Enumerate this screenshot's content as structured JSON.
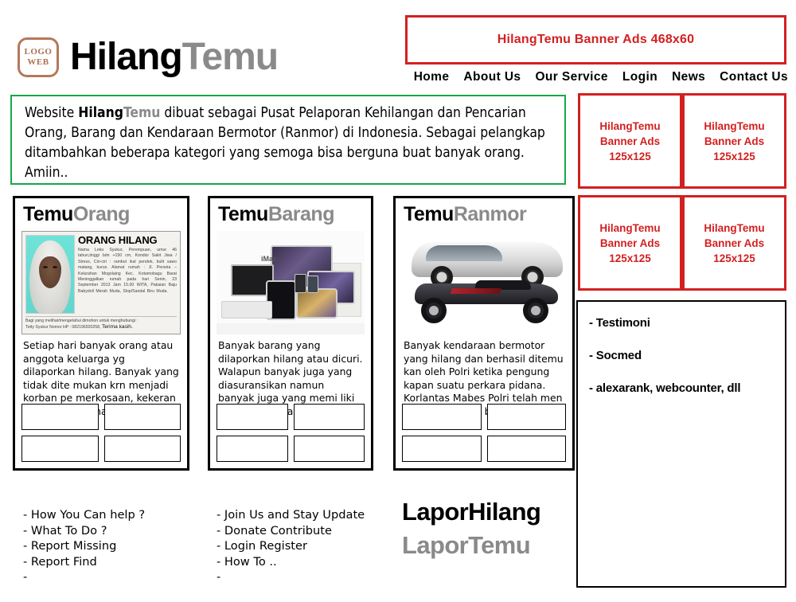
{
  "header": {
    "logo": {
      "line1": "LOGO",
      "line2": "WEB",
      "color": "#a9714f"
    },
    "title_black": "Hilang",
    "title_grey": "Temu",
    "nav": [
      {
        "label": "Home"
      },
      {
        "label": "About Us"
      },
      {
        "label": "Our Service"
      },
      {
        "label": "Login"
      },
      {
        "label": "News"
      },
      {
        "label": "Contact Us"
      }
    ]
  },
  "top_banner": {
    "label": "HilangTemu Banner Ads 468x60",
    "color": "#d32020"
  },
  "description": {
    "pre": "Website ",
    "brand_black": "Hilang",
    "brand_grey": "Temu",
    "rest": " dibuat sebagai Pusat Pelaporan Kehilangan dan Pencarian Orang, Barang dan Kendaraan Bermotor (Ranmor) di Indonesia. Sebagai pelangkap ditambahkan beberapa kategori yang semoga bisa berguna buat banyak orang. Amiin..",
    "border_color": "#17a74a"
  },
  "cards": [
    {
      "title_a": "Temu",
      "title_b": "Orang",
      "body": "Setiap hari banyak orang atau anggota keluarga yg dilaporkan hilang. Banyak yang tidak dite mukan krn menjadi korban pe merkosaan, kekeran dan pem bunuhan ...",
      "poster": {
        "heading": "ORANG HILANG",
        "lines": "Nama Leku Syukur, Perempuan, umur 46 tahun,tinggi bdn  +150 cm, Kondisi Sakit Jiwa / Stress, Ciri-ciri : rambut ikal pendek, bulit sawo matang, kurus. Alamat rumah : Jl. Perwira – Kelurahan Mogolaing Kec. Kotamobagu Barat Meninggalkan rumah pada hari Senin, 23 September 2013 Jam 15.00 WITA, Pakaian Baju Babydoll Merah Muda, Slop/Sandal Biru Muda.",
        "foot": "Bagi yang melihat/mengetahui dimohon untuk menghubungi :",
        "foot2": "Tetty Syukur   Nomor HP : 082196920258,",
        "foot3": "Terima kasih."
      }
    },
    {
      "title_a": "Temu",
      "title_b": "Barang",
      "body": "Banyak barang yang dilaporkan hilang atau dicuri. Walapun banyak juga yang diasuransikan namun banyak juga yang memi liki nilai historis bagi pemiliknya ....",
      "art_label": "iMac"
    },
    {
      "title_a": "Temu",
      "title_b": "Ranmor",
      "body": "Banyak kendaraan bermotor yang hilang dan berhasil ditemu kan oleh Polri ketika pengung kapan suatu perkara pidana. Korlantas Mabes Polri telah men data kendaraan bermotor tsbt .."
    }
  ],
  "side_ads": [
    {
      "label": "HilangTemu Banner Ads 125x125"
    },
    {
      "label": "HilangTemu Banner Ads 125x125"
    },
    {
      "label": "HilangTemu Banner Ads 125x125"
    },
    {
      "label": "HilangTemu Banner Ads 125x125"
    }
  ],
  "side_panel": {
    "items": [
      "- Testimoni",
      "- Socmed",
      "- alexarank, webcounter, dll"
    ]
  },
  "footer": {
    "col1": [
      "- How You Can help ?",
      "- What To Do ?",
      "- Report Missing",
      "- Report Find",
      "-"
    ],
    "col2": [
      "- Join Us and Stay Update",
      "- Donate Contribute",
      "- Login Register",
      "- How To ..",
      "-"
    ],
    "lapor_hilang": "LaporHilang",
    "lapor_temu": "LaporTemu"
  }
}
